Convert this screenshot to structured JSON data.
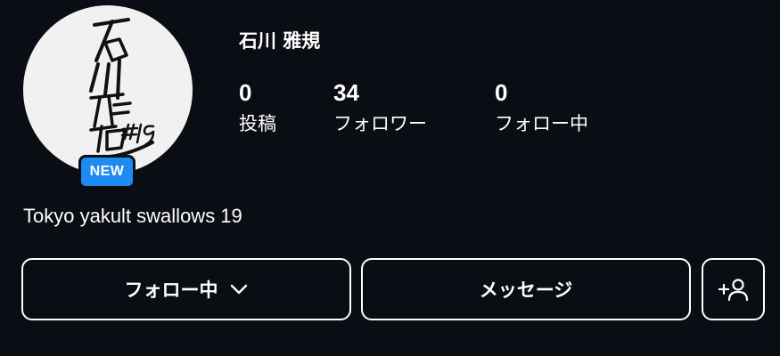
{
  "profile": {
    "username": "石川 雅規",
    "badge": "NEW",
    "avatar_signature": "石川雅規 #19",
    "bio": "Tokyo yakult swallows 19"
  },
  "stats": {
    "posts": {
      "value": "0",
      "label": "投稿"
    },
    "followers": {
      "value": "34",
      "label": "フォロワー"
    },
    "following": {
      "value": "0",
      "label": "フォロー中"
    }
  },
  "actions": {
    "following_label": "フォロー中",
    "following_icon": "chevron-down-icon",
    "message_label": "メッセージ",
    "suggest_icon": "add-person-icon"
  },
  "colors": {
    "background": "#0b0d14",
    "badge": "#1d8bf1",
    "text": "#ffffff"
  }
}
